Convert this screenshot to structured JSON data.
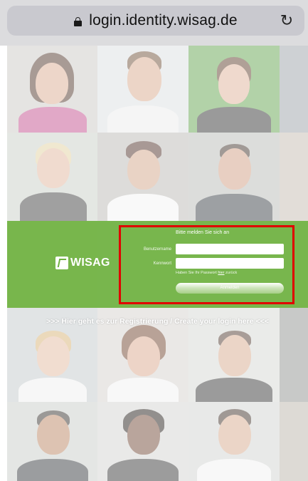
{
  "browser": {
    "url": "login.identity.wisag.de",
    "reload_icon": "↻"
  },
  "brand": {
    "logo_text": "WISAG",
    "accent_color": "#6fb240"
  },
  "login": {
    "title": "Bitte melden Sie sich an",
    "username_label": "Benutzername",
    "username_value": "",
    "password_label": "Kennwort",
    "password_value": "",
    "forgot_prefix": "Haben Sie Ihr Passwort",
    "forgot_link": "hier",
    "forgot_suffix": "zurück",
    "submit_label": "Anmelden"
  },
  "register": {
    "link_text": ">>> Hier geht es zur Registrierung / Create your login here <<<"
  }
}
